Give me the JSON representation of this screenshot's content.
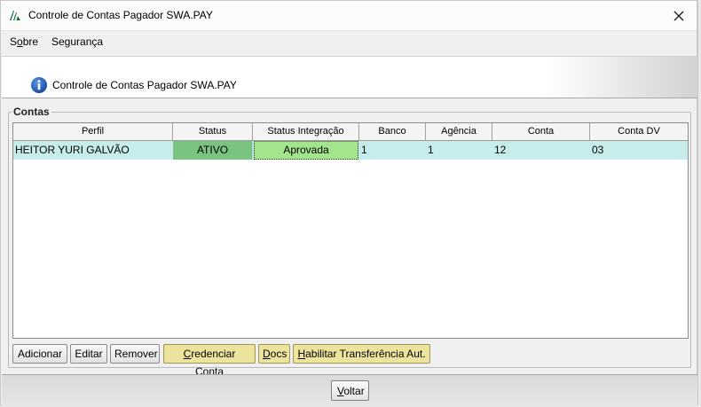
{
  "window": {
    "title": "Controle de Contas Pagador SWA.PAY",
    "close_glyph": "✕"
  },
  "menu": {
    "items": [
      {
        "mnemonic": "o",
        "pre": "S",
        "post": "bre"
      },
      {
        "mnemonic": "",
        "pre": "Segurança",
        "post": ""
      }
    ]
  },
  "header": {
    "title": "Controle de Contas Pagador SWA.PAY",
    "icon": "info-icon"
  },
  "group": {
    "legend": "Contas"
  },
  "table": {
    "columns": [
      "Perfil",
      "Status",
      "Status Integração",
      "Banco",
      "Agência",
      "Conta",
      "Conta DV"
    ],
    "rows": [
      {
        "perfil": "HEITOR YURI GALVÃO",
        "status": "ATIVO",
        "status_integracao": "Aprovada",
        "banco": "1",
        "agencia": "1",
        "conta": "12",
        "conta_dv": "03"
      }
    ]
  },
  "buttons": {
    "adicionar": "Adicionar",
    "editar": "Editar",
    "remover": "Remover",
    "credenciar": {
      "mnemonic": "C",
      "rest": "redenciar Conta"
    },
    "docs": {
      "mnemonic": "D",
      "rest": "ocs"
    },
    "habilitar": {
      "mnemonic": "H",
      "rest": "abilitar Transferência Aut."
    },
    "voltar": {
      "mnemonic": "V",
      "rest": "oltar"
    }
  },
  "colors": {
    "row_bg": "#c7ecec",
    "status_ativo": "#7ac381",
    "status_aprovada": "#a3e58d",
    "accent_button": "#ece39d"
  }
}
